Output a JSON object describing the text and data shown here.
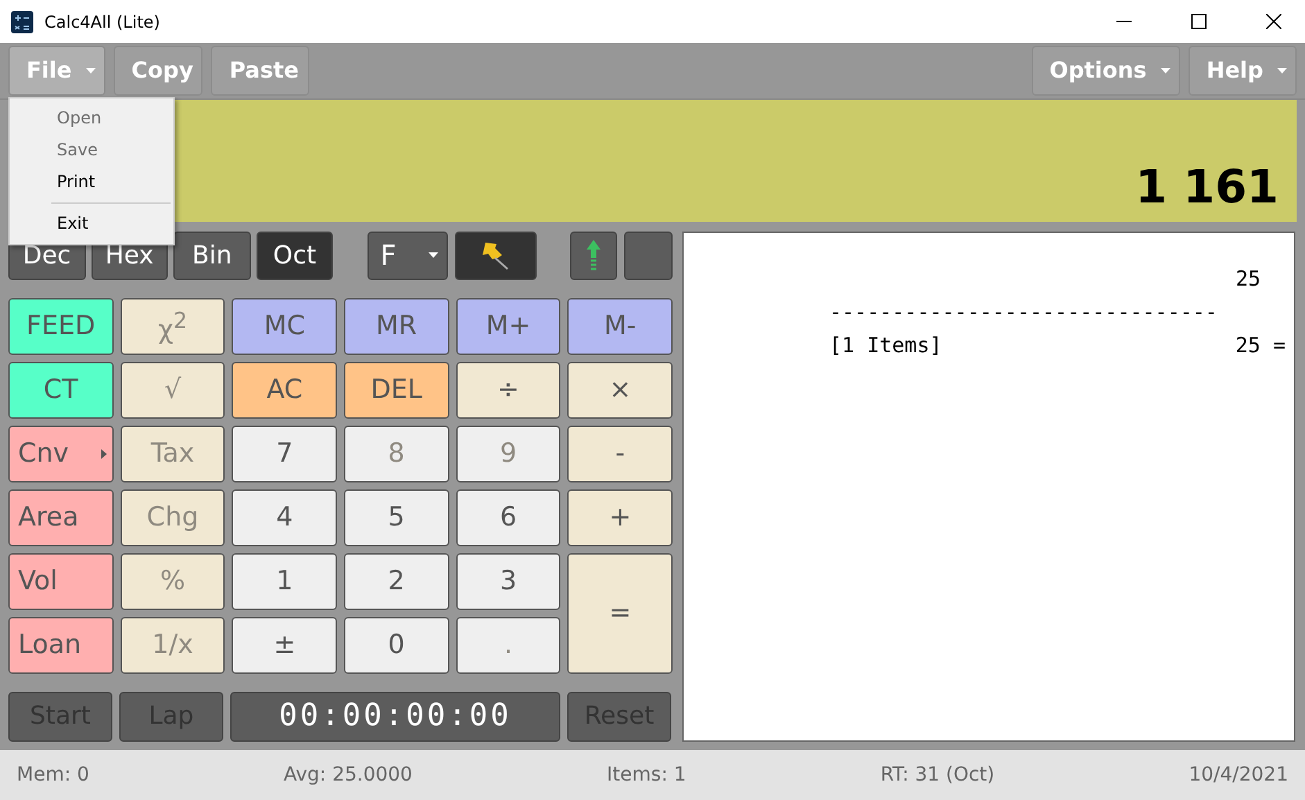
{
  "window": {
    "title": "Calc4All (Lite)"
  },
  "toolbar": {
    "left": [
      {
        "label": "File",
        "dropdown": true,
        "expanded": true
      },
      {
        "label": "Copy",
        "dropdown": false,
        "expanded": false
      },
      {
        "label": "Paste",
        "dropdown": false,
        "expanded": false
      }
    ],
    "right": [
      {
        "label": "Options",
        "dropdown": true,
        "expanded": false
      },
      {
        "label": "Help",
        "dropdown": true,
        "expanded": false
      }
    ]
  },
  "file_menu": [
    {
      "kind": "item",
      "label": "Open",
      "disabled": true
    },
    {
      "kind": "item",
      "label": "Save",
      "disabled": true
    },
    {
      "kind": "item",
      "label": "Print",
      "disabled": false
    },
    {
      "kind": "separator"
    },
    {
      "kind": "item",
      "label": "Exit",
      "disabled": false
    }
  ],
  "display": {
    "value": "1 161"
  },
  "modes": [
    {
      "label": "Dec",
      "selected": false
    },
    {
      "label": "Hex",
      "selected": false
    },
    {
      "label": "Bin",
      "selected": false
    },
    {
      "label": "Oct",
      "selected": true
    }
  ],
  "format_dropdown": {
    "label": "F"
  },
  "keys": [
    {
      "label": "FEED",
      "kind": "teal",
      "disabled": false
    },
    {
      "label": "χ$^{2}$",
      "kind": "cream",
      "disabled": true
    },
    {
      "label": "MC",
      "kind": "memory",
      "disabled": false
    },
    {
      "label": "MR",
      "kind": "memory",
      "disabled": false
    },
    {
      "label": "M+",
      "kind": "memory",
      "disabled": false
    },
    {
      "label": "M-",
      "kind": "memory",
      "disabled": false
    },
    {
      "label": "CT",
      "kind": "teal",
      "disabled": false
    },
    {
      "label": "√",
      "kind": "cream",
      "disabled": true
    },
    {
      "label": "AC",
      "kind": "clear",
      "disabled": false
    },
    {
      "label": "DEL",
      "kind": "clear",
      "disabled": false
    },
    {
      "label": "÷",
      "kind": "cream",
      "disabled": false
    },
    {
      "label": "×",
      "kind": "cream",
      "disabled": false
    },
    {
      "label": "Cnv",
      "kind": "convert",
      "disabled": false,
      "submenu": true
    },
    {
      "label": "Tax",
      "kind": "cream",
      "disabled": true
    },
    {
      "label": "7",
      "kind": "digit",
      "disabled": false
    },
    {
      "label": "8",
      "kind": "digit",
      "disabled": true
    },
    {
      "label": "9",
      "kind": "digit",
      "disabled": true
    },
    {
      "label": "-",
      "kind": "cream",
      "disabled": false
    },
    {
      "label": "Area",
      "kind": "convert",
      "disabled": false
    },
    {
      "label": "Chg",
      "kind": "cream",
      "disabled": true
    },
    {
      "label": "4",
      "kind": "digit",
      "disabled": false
    },
    {
      "label": "5",
      "kind": "digit",
      "disabled": false
    },
    {
      "label": "6",
      "kind": "digit",
      "disabled": false
    },
    {
      "label": "+",
      "kind": "cream",
      "disabled": false
    },
    {
      "label": "Vol",
      "kind": "convert",
      "disabled": false
    },
    {
      "label": "%",
      "kind": "cream",
      "disabled": true
    },
    {
      "label": "1",
      "kind": "digit",
      "disabled": false
    },
    {
      "label": "2",
      "kind": "digit",
      "disabled": false
    },
    {
      "label": "3",
      "kind": "digit",
      "disabled": false
    },
    {
      "label": "=",
      "kind": "cream",
      "disabled": false,
      "tall": true
    },
    {
      "label": "Loan",
      "kind": "convert",
      "disabled": false
    },
    {
      "label": "1/x",
      "kind": "cream",
      "disabled": true
    },
    {
      "label": "±",
      "kind": "digit",
      "disabled": false
    },
    {
      "label": "0",
      "kind": "digit",
      "disabled": false
    },
    {
      "label": ".",
      "kind": "digit",
      "disabled": true
    }
  ],
  "timer": {
    "start": "Start",
    "lap": "Lap",
    "time": "00:00:00:00",
    "reset": "Reset"
  },
  "tape": [
    {
      "kind": "entry",
      "value": "25"
    },
    {
      "kind": "rule",
      "text": "-------------------------------"
    },
    {
      "kind": "total",
      "label": "[1 Items]",
      "value": "25 ="
    }
  ],
  "status_bar": [
    "Mem: 0",
    "Avg: 25.0000",
    "Items: 1",
    "RT: 31 (Oct)",
    "10/4/2021"
  ]
}
